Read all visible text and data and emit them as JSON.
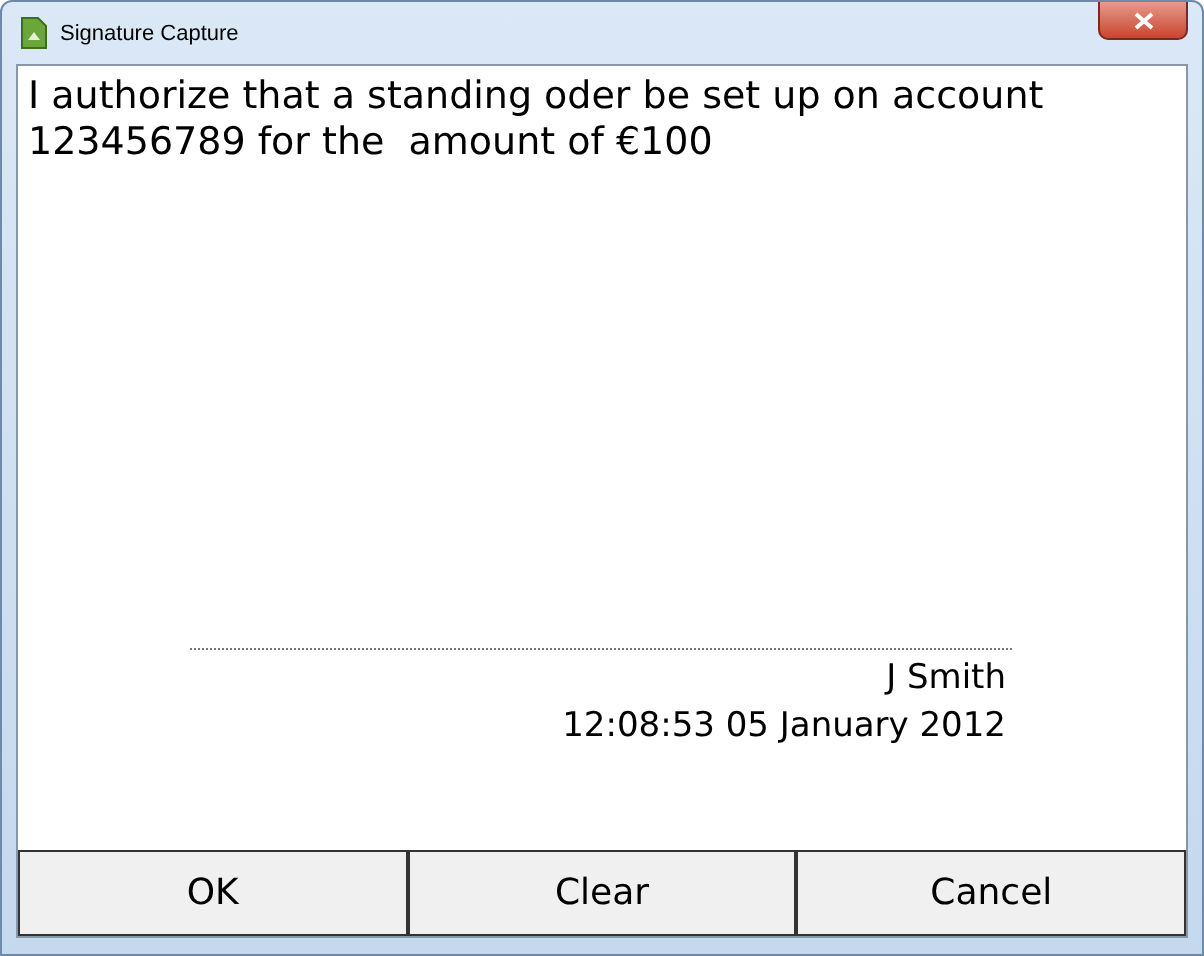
{
  "window": {
    "title": "Signature Capture"
  },
  "statement": "I authorize that a standing oder be set up on account 123456789 for the  amount of €100",
  "signer": "J Smith",
  "timestamp": "12:08:53 05 January 2012",
  "buttons": [
    "OK",
    "Clear",
    "Cancel"
  ]
}
